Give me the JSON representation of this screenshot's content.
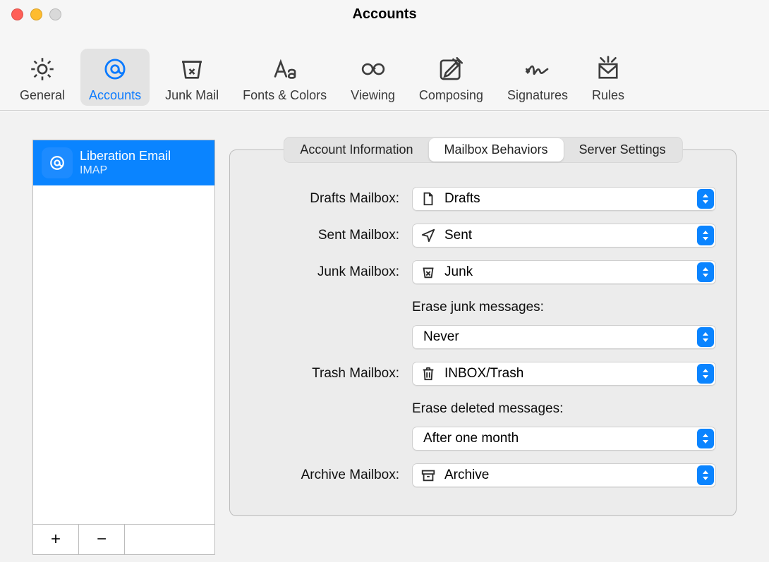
{
  "window": {
    "title": "Accounts"
  },
  "toolbar": {
    "items": [
      {
        "key": "general",
        "label": "General",
        "icon": "gear-icon"
      },
      {
        "key": "accounts",
        "label": "Accounts",
        "icon": "at-icon",
        "active": true
      },
      {
        "key": "junk",
        "label": "Junk Mail",
        "icon": "junk-icon"
      },
      {
        "key": "fonts",
        "label": "Fonts & Colors",
        "icon": "aa-icon"
      },
      {
        "key": "viewing",
        "label": "Viewing",
        "icon": "glasses-icon"
      },
      {
        "key": "composing",
        "label": "Composing",
        "icon": "compose-icon"
      },
      {
        "key": "signatures",
        "label": "Signatures",
        "icon": "signature-icon"
      },
      {
        "key": "rules",
        "label": "Rules",
        "icon": "rules-icon"
      }
    ]
  },
  "sidebar": {
    "accounts": [
      {
        "name": "Liberation Email",
        "protocol": "IMAP",
        "icon": "at-badge"
      }
    ],
    "add_label": "+",
    "remove_label": "−"
  },
  "tabs": [
    {
      "key": "info",
      "label": "Account Information"
    },
    {
      "key": "mailbox",
      "label": "Mailbox Behaviors",
      "active": true
    },
    {
      "key": "server",
      "label": "Server Settings"
    }
  ],
  "form": {
    "drafts_label": "Drafts Mailbox:",
    "drafts_value": "Drafts",
    "sent_label": "Sent Mailbox:",
    "sent_value": "Sent",
    "junk_label": "Junk Mailbox:",
    "junk_value": "Junk",
    "erase_junk_header": "Erase junk messages:",
    "erase_junk_value": "Never",
    "trash_label": "Trash Mailbox:",
    "trash_value": "INBOX/Trash",
    "erase_deleted_header": "Erase deleted messages:",
    "erase_deleted_value": "After one month",
    "archive_label": "Archive Mailbox:",
    "archive_value": "Archive"
  }
}
